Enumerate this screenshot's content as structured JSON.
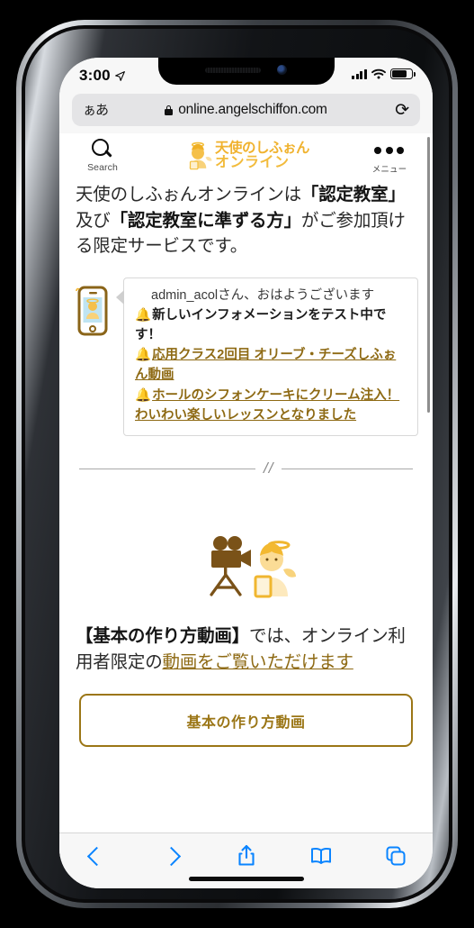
{
  "status_bar": {
    "time": "3:00",
    "location_icon": "location-arrow-icon",
    "cellular_icon": "signal-bars-icon",
    "wifi_icon": "wifi-icon",
    "battery_icon": "battery-icon"
  },
  "browser": {
    "text_size_button": "ぁあ",
    "lock_icon": "lock-icon",
    "url": "online.angelschiffon.com",
    "reload_icon": "reload-icon",
    "toolbar": {
      "back": "back-chevron-icon",
      "forward": "forward-chevron-icon",
      "share": "share-icon",
      "bookmarks": "book-icon",
      "tabs": "tabs-icon"
    }
  },
  "site": {
    "search_label": "Search",
    "menu_label": "メニュー",
    "logo": {
      "line1": "天使のしふぉん",
      "line2": "オンライン"
    },
    "lead": {
      "p1": "天使のしふぉんオンラインは",
      "b1": "「認定教室」",
      "p2": "及び",
      "b2": "「認定教室に準ずる方」",
      "p3": "がご参加頂ける限定サービスです。"
    },
    "notification": {
      "greeting": "admin_acolさん、おはようございます",
      "bell_icon": "bell-icon",
      "items": [
        {
          "text": "新しいインフォメーションをテスト中です！",
          "is_link": false
        },
        {
          "text": "応用クラス2回目 オリーブ・チーズしふぉん動画",
          "is_link": true
        },
        {
          "text": "ホールのシフォンケーキにクリーム注入！わいわい楽しいレッスンとなりました",
          "is_link": true
        }
      ]
    },
    "divider_mark": "//",
    "illustration": "movie-camera-and-angel-icon",
    "promo": {
      "bold": "【基本の作り方動画】",
      "mid": "では、オンライン利用者限定の",
      "link": "動画をご覧いただけます"
    },
    "cta_label": "基本の作り方動画"
  },
  "colors": {
    "brand_gold": "#f0b22e",
    "link_brown": "#8e6a14",
    "cta_border": "#9b7616",
    "ios_blue": "#0a84ff"
  }
}
